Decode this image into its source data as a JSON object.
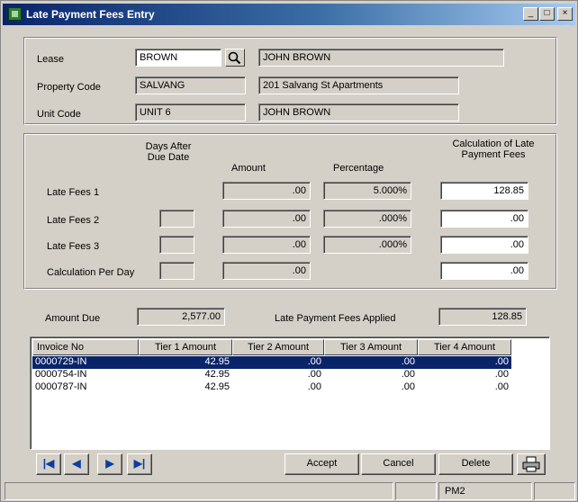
{
  "window": {
    "title": "Late Payment Fees Entry"
  },
  "titlebar_buttons": {
    "minimize": "_",
    "maximize": "□",
    "close": "×"
  },
  "header": {
    "lease_label": "Lease",
    "lease_value": "BROWN",
    "lease_name": "JOHN BROWN",
    "property_label": "Property Code",
    "property_value": "SALVANG",
    "property_name": "201 Salvang St Apartments",
    "unit_label": "Unit Code",
    "unit_value": "UNIT 6",
    "unit_name": "JOHN BROWN"
  },
  "fees": {
    "col_days": "Days After Due Date",
    "col_amount": "Amount",
    "col_percentage": "Percentage",
    "col_calc": "Calculation of Late Payment Fees",
    "rows": [
      {
        "label": "Late Fees 1",
        "days": "",
        "amount": ".00",
        "percentage": "5.000%",
        "calc": "128.85"
      },
      {
        "label": "Late Fees 2",
        "days": "",
        "amount": ".00",
        "percentage": ".000%",
        "calc": ".00"
      },
      {
        "label": "Late Fees 3",
        "days": "",
        "amount": ".00",
        "percentage": ".000%",
        "calc": ".00"
      },
      {
        "label": "Calculation Per Day",
        "days": "",
        "amount": ".00",
        "percentage": "",
        "calc": ".00"
      }
    ]
  },
  "totals": {
    "amount_due_label": "Amount Due",
    "amount_due": "2,577.00",
    "applied_label": "Late Payment Fees Applied",
    "applied": "128.85"
  },
  "grid": {
    "columns": [
      "Invoice No",
      "Tier 1 Amount",
      "Tier 2 Amount",
      "Tier 3 Amount",
      "Tier 4 Amount"
    ],
    "rows": [
      [
        "0000729-IN",
        "42.95",
        ".00",
        ".00",
        ".00"
      ],
      [
        "0000754-IN",
        "42.95",
        ".00",
        ".00",
        ".00"
      ],
      [
        "0000787-IN",
        "42.95",
        ".00",
        ".00",
        ".00"
      ]
    ],
    "selected_index": 0
  },
  "buttons": {
    "first": "|◀",
    "prev": "◀",
    "next": "▶",
    "last": "▶|",
    "accept": "Accept",
    "cancel": "Cancel",
    "delete": "Delete",
    "print_icon": "printer-icon"
  },
  "status": {
    "company": "PM2"
  }
}
